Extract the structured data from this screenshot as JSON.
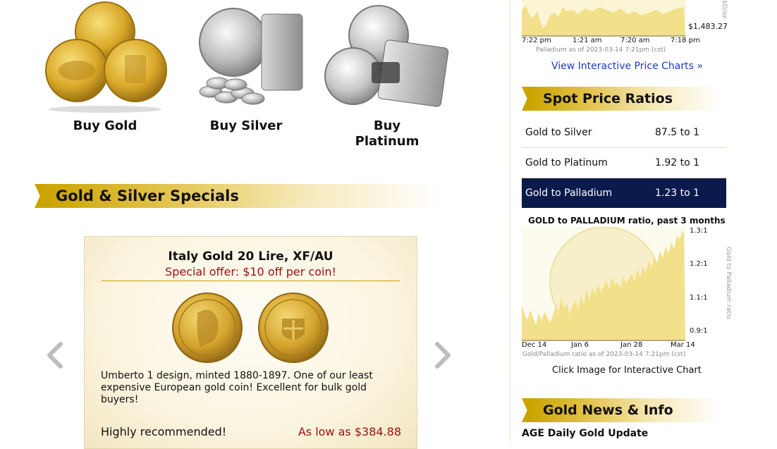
{
  "categories": [
    {
      "label": "Buy Gold"
    },
    {
      "label": "Buy Silver"
    },
    {
      "label": "Buy Platinum"
    }
  ],
  "specials": {
    "heading": "Gold & Silver Specials",
    "card": {
      "title": "Italy Gold 20 Lire, XF/AU",
      "offer": "Special offer: $10 off per coin!",
      "description": "Umberto 1 design, minted 1880-1897. One of our least expensive European gold coin! Excellent for bulk gold buyers!",
      "recommendation": "Highly recommended!",
      "price": "As low as $384.88"
    }
  },
  "palladium_chart": {
    "last_value": "$1,483.27",
    "side_label": "$D/oz",
    "x_ticks": [
      "7:22 pm",
      "1:21 am",
      "7:20 am",
      "7:18 pm"
    ],
    "caption": "Palladium as of 2023-03-14 7:21pm (cst)",
    "link": "View Interactive Price Charts »"
  },
  "ratios": {
    "heading": "Spot Price Ratios",
    "rows": [
      {
        "label": "Gold to Silver",
        "value": "87.5 to 1"
      },
      {
        "label": "Gold to Platinum",
        "value": "1.92 to 1"
      },
      {
        "label": "Gold to Palladium",
        "value": "1.23 to 1"
      }
    ]
  },
  "ratio_chart": {
    "title": "GOLD to PALLADIUM ratio, past 3 months",
    "y_ticks": [
      "1.3:1",
      "1.2:1",
      "1.1:1",
      "0.9:1"
    ],
    "x_ticks": [
      "Dec 14",
      "Jan 6",
      "Jan 28",
      "Mar 14"
    ],
    "side_label": "Gold to Palladium ratio",
    "caption": "Gold/Palladium ratio as of 2023-03-14 7:21pm (cst)",
    "link": "Click Image for Interactive Chart"
  },
  "news": {
    "heading": "Gold News & Info",
    "first_item": "AGE Daily Gold Update"
  },
  "colors": {
    "gold_band": "#c9a400",
    "navy": "#0b1a4c",
    "offer_red": "#a01010",
    "link_blue": "#1a3cc8",
    "chart_fill": "#f2e08a"
  }
}
